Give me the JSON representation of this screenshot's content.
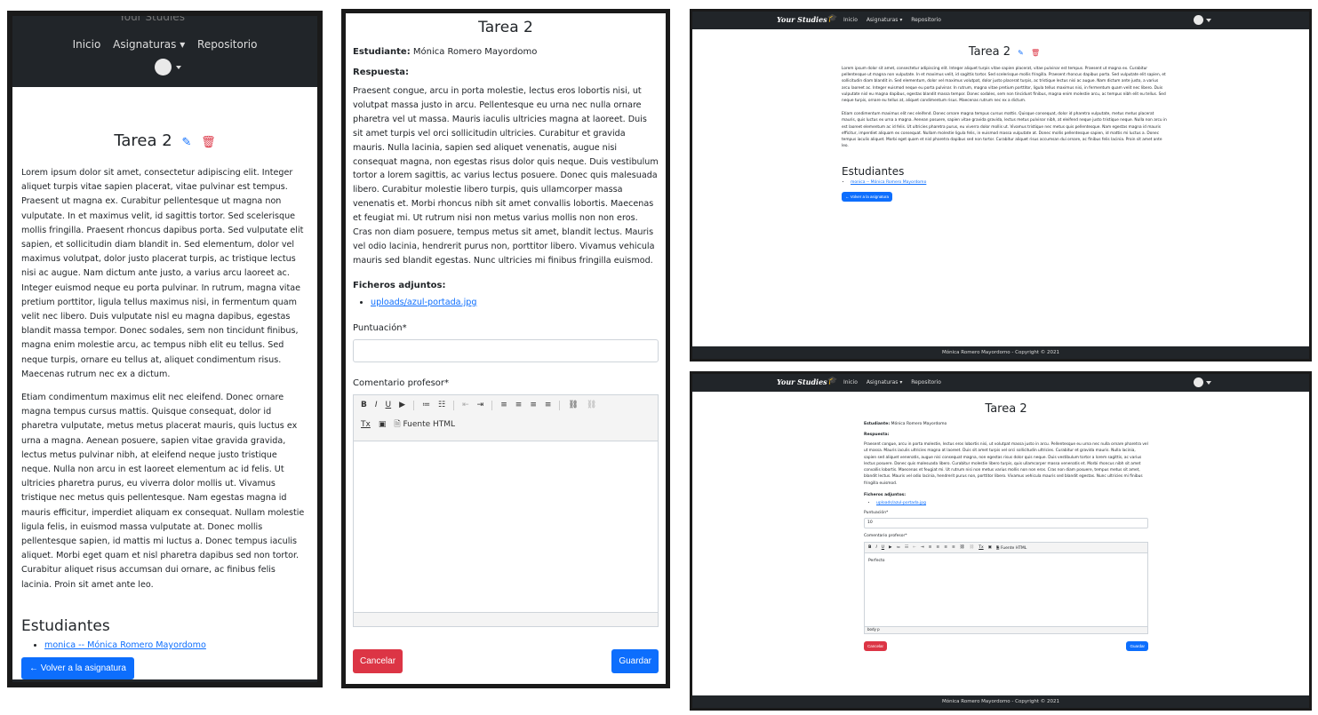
{
  "nav": {
    "brand": "Your Studies",
    "brand_cut": "Your Studies",
    "links": [
      "Inicio",
      "Asignaturas ▾",
      "Repositorio"
    ]
  },
  "task": {
    "title": "Tarea 2",
    "description_p1": "Lorem ipsum dolor sit amet, consectetur adipiscing elit. Integer aliquet turpis vitae sapien placerat, vitae pulvinar est tempus. Praesent ut magna ex. Curabitur pellentesque ut magna non vulputate. In et maximus velit, id sagittis tortor. Sed scelerisque mollis fringilla. Praesent rhoncus dapibus porta. Sed vulputate elit sapien, et sollicitudin diam blandit in. Sed elementum, dolor vel maximus volutpat, dolor justo placerat turpis, ac tristique lectus nisi ac augue. Nam dictum ante justo, a varius arcu laoreet ac. Integer euismod neque eu porta pulvinar. In rutrum, magna vitae pretium porttitor, ligula tellus maximus nisi, in fermentum quam velit nec libero. Duis vulputate nisl eu magna dapibus, egestas blandit massa tempor. Donec sodales, sem non tincidunt finibus, magna enim molestie arcu, ac tempus nibh elit eu tellus. Sed neque turpis, ornare eu tellus at, aliquet condimentum risus. Maecenas rutrum nec ex a dictum.",
    "description_p2": "Etiam condimentum maximus elit nec eleifend. Donec ornare magna tempus cursus mattis. Quisque consequat, dolor id pharetra vulputate, metus metus placerat mauris, quis luctus ex urna a magna. Aenean posuere, sapien vitae gravida gravida, lectus metus pulvinar nibh, at eleifend neque justo tristique neque. Nulla non arcu in est laoreet elementum ac id felis. Ut ultricies pharetra purus, eu viverra dolor mollis ut. Vivamus tristique nec metus quis pellentesque. Nam egestas magna id mauris efficitur, imperdiet aliquam ex consequat. Nullam molestie ligula felis, in euismod massa vulputate at. Donec mollis pellentesque sapien, id mattis mi luctus a. Donec tempus iaculis aliquet. Morbi eget quam et nisl pharetra dapibus sed non tortor. Curabitur aliquet risus accumsan dui ornare, ac finibus felis lacinia. Proin sit amet ante leo.",
    "students_heading": "Estudiantes",
    "student_link": "monica -- Mónica Romero Mayordomo",
    "back_button": "← Volver a la asignatura"
  },
  "grading": {
    "student_label": "Estudiante:",
    "student_name": "Mónica Romero Mayordomo",
    "answer_label": "Respuesta:",
    "answer_text": "Praesent congue, arcu in porta molestie, lectus eros lobortis nisi, ut volutpat massa justo in arcu. Pellentesque eu urna nec nulla ornare pharetra vel ut massa. Mauris iaculis ultricies magna at laoreet. Duis sit amet turpis vel orci sollicitudin ultricies. Curabitur et gravida mauris. Nulla lacinia, sapien sed aliquet venenatis, augue nisi consequat magna, non egestas risus dolor quis neque. Duis vestibulum tortor a lorem sagittis, ac varius lectus posuere. Donec quis malesuada libero. Curabitur molestie libero turpis, quis ullamcorper massa venenatis et. Morbi rhoncus nibh sit amet convallis lobortis. Maecenas et feugiat mi. Ut rutrum nisi non metus varius mollis non non eros. Cras non diam posuere, tempus metus sit amet, blandit lectus. Mauris vel odio lacinia, hendrerit purus non, porttitor libero. Vivamus vehicula mauris sed blandit egestas. Nunc ultricies mi finibus fringilla euismod.",
    "attachments_label": "Ficheros adjuntos:",
    "attachment_link": "uploads/azul-portada.jpg",
    "score_label": "Puntuación*",
    "score_value": "10",
    "comment_label": "Comentario profesor*",
    "comment_value": "Perfecto",
    "toolbar_row1": [
      "B",
      "I",
      "U",
      "▶",
      "≔",
      "☷",
      "⇤",
      "⇥",
      "≡",
      "≡",
      "≡",
      "≡",
      "⛓",
      "⛓"
    ],
    "toolbar_row2": [
      "Tx",
      "▣",
      "🗎 Fuente HTML"
    ],
    "editor_path": "body  p",
    "cancel_button": "Cancelar",
    "save_button": "Guardar"
  },
  "footer": {
    "text": "Mónica Romero Mayordomo - Copyright © 2021"
  },
  "colors": {
    "navbar": "#212529",
    "primary": "#0d6efd",
    "danger": "#dc3545",
    "edit_icon": "#0d6efd",
    "delete_icon": "#dc3545"
  },
  "icons": {
    "edit": "pencil-icon",
    "delete": "trash-icon"
  }
}
